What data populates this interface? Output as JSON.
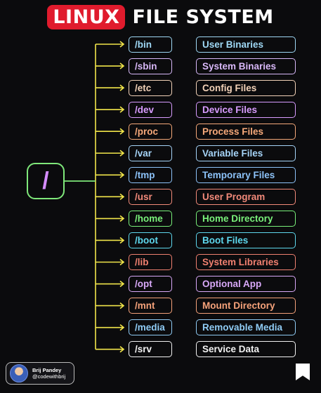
{
  "title": {
    "badge": "LINUX",
    "rest": "FILE SYSTEM"
  },
  "root": {
    "label": "/"
  },
  "rows": [
    {
      "dir": "/bin",
      "desc": "User Binaries",
      "dir_color": "#9fd8f5",
      "desc_color": "#9fd8f5"
    },
    {
      "dir": "/sbin",
      "desc": "System Binaries",
      "dir_color": "#d8b8f8",
      "desc_color": "#d8b8f8"
    },
    {
      "dir": "/etc",
      "desc": "Config Files",
      "dir_color": "#f2d2b8",
      "desc_color": "#f2d2b8"
    },
    {
      "dir": "/dev",
      "desc": "Device Files",
      "dir_color": "#d89cff",
      "desc_color": "#d89cff"
    },
    {
      "dir": "/proc",
      "desc": "Process Files",
      "dir_color": "#f6a97a",
      "desc_color": "#f6a97a"
    },
    {
      "dir": "/var",
      "desc": "Variable Files",
      "dir_color": "#a6d4f8",
      "desc_color": "#a6d4f8"
    },
    {
      "dir": "/tmp",
      "desc": "Temporary Files",
      "dir_color": "#8cc2f8",
      "desc_color": "#8cc2f8"
    },
    {
      "dir": "/usr",
      "desc": "User Program",
      "dir_color": "#f28a7a",
      "desc_color": "#f28a7a"
    },
    {
      "dir": "/home",
      "desc": "Home Directory",
      "dir_color": "#79f07a",
      "desc_color": "#79f07a"
    },
    {
      "dir": "/boot",
      "desc": "Boot Files",
      "dir_color": "#5ed8ee",
      "desc_color": "#5ed8ee"
    },
    {
      "dir": "/lib",
      "desc": "System Libraries",
      "dir_color": "#f08070",
      "desc_color": "#f08070"
    },
    {
      "dir": "/opt",
      "desc": "Optional App",
      "dir_color": "#d8a8f8",
      "desc_color": "#d8a8f8"
    },
    {
      "dir": "/mnt",
      "desc": "Mount Directory",
      "dir_color": "#f5a27a",
      "desc_color": "#f5a27a"
    },
    {
      "dir": "/media",
      "desc": "Removable Media",
      "dir_color": "#90ccf5",
      "desc_color": "#90ccf5"
    },
    {
      "dir": "/srv",
      "desc": "Service Data",
      "dir_color": "#f2f2f2",
      "desc_color": "#f2f2f2"
    }
  ],
  "colors": {
    "wire": "#f2e64a",
    "root_wire": "#7fe87a",
    "background": "#0b0b0d"
  },
  "footer": {
    "name": "Brij Pandey",
    "handle": "@codewithbrij",
    "bookmark_icon": "bookmark-icon"
  }
}
